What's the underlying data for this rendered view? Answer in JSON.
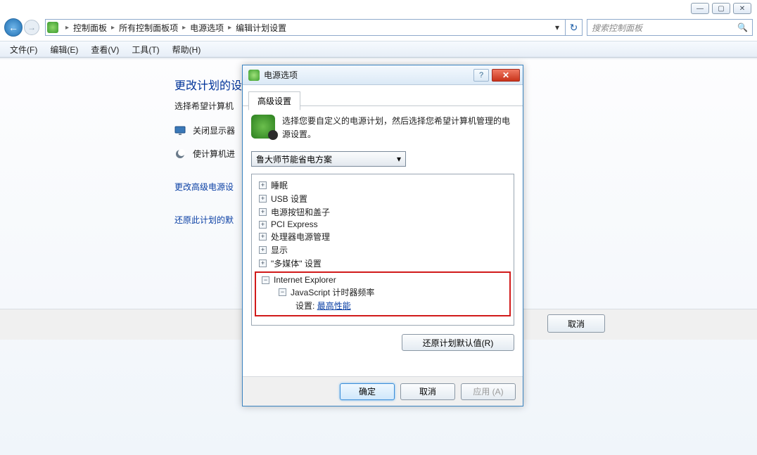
{
  "window": {
    "breadcrumb": {
      "root": "控制面板",
      "l2": "所有控制面板项",
      "l3": "电源选项",
      "l4": "编辑计划设置"
    },
    "search_placeholder": "搜索控制面板",
    "menus": {
      "file": "文件(F)",
      "edit": "编辑(E)",
      "view": "查看(V)",
      "tools": "工具(T)",
      "help": "帮助(H)"
    }
  },
  "page": {
    "title": "更改计划的设",
    "subtitle": "选择希望计算机",
    "row_turn_off": "关闭显示器",
    "row_sleep": "使计算机进",
    "link_advanced": "更改高级电源设",
    "link_restore": "还原此计划的默",
    "cancel": "取消"
  },
  "dialog": {
    "title": "电源选项",
    "tab": "高级设置",
    "info": "选择您要自定义的电源计划，然后选择您希望计算机管理的电源设置。",
    "plan": "鲁大师节能省电方案",
    "tree": {
      "sleep": "睡眠",
      "usb": "USB 设置",
      "button_lid": "电源按钮和盖子",
      "pci": "PCI Express",
      "cpu": "处理器电源管理",
      "display": "显示",
      "media": "\"多媒体\" 设置",
      "ie": "Internet Explorer",
      "js_timer": "JavaScript 计时器频率",
      "setting_label": "设置:",
      "setting_value": "最高性能"
    },
    "restore": "还原计划默认值(R)",
    "ok": "确定",
    "cancel": "取消",
    "apply": "应用 (A)"
  }
}
